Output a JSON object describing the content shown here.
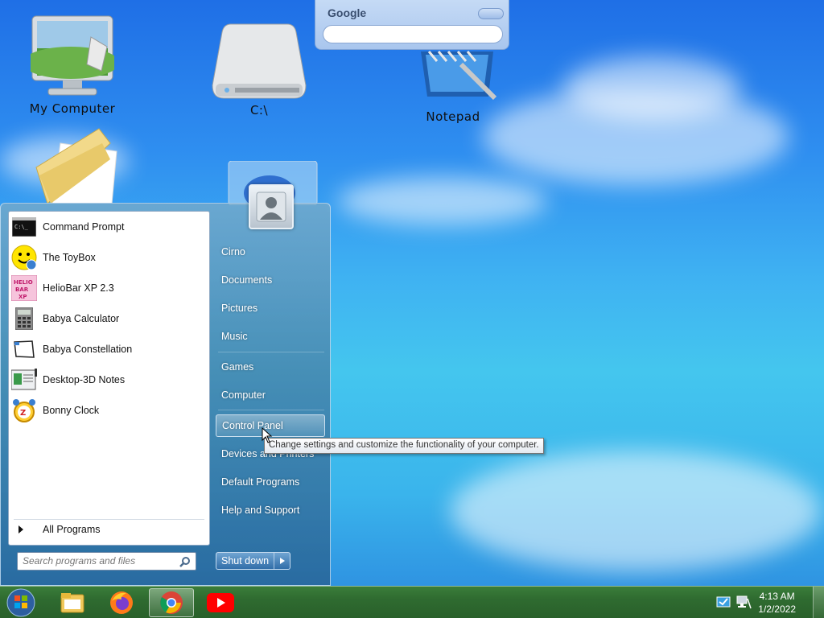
{
  "desktop": {
    "icons": [
      {
        "label": "My Computer"
      },
      {
        "label": "C:\\"
      },
      {
        "label": "Notepad"
      }
    ]
  },
  "gadget": {
    "title": "Google",
    "search_value": ""
  },
  "start_menu": {
    "programs": [
      {
        "label": "Command Prompt",
        "icon": "command-prompt-icon"
      },
      {
        "label": "The ToyBox",
        "icon": "smiley-icon"
      },
      {
        "label": "HelioBar XP 2.3",
        "icon": "heliobar-icon"
      },
      {
        "label": "Babya Calculator",
        "icon": "calculator-icon"
      },
      {
        "label": "Babya Constellation",
        "icon": "constellation-icon"
      },
      {
        "label": "Desktop-3D Notes",
        "icon": "notes-icon"
      },
      {
        "label": "Bonny Clock",
        "icon": "alarm-clock-icon"
      }
    ],
    "all_programs": "All Programs",
    "search_placeholder": "Search programs and files",
    "right_items": [
      {
        "label": "Cirno"
      },
      {
        "label": "Documents"
      },
      {
        "label": "Pictures"
      },
      {
        "label": "Music"
      },
      {
        "label": "Games"
      },
      {
        "label": "Computer"
      },
      {
        "label": "Control Panel"
      },
      {
        "label": "Devices and Printers"
      },
      {
        "label": "Default Programs"
      },
      {
        "label": "Help and Support"
      }
    ],
    "shutdown_label": "Shut down",
    "tooltip": "Change settings and customize the functionality of your computer."
  },
  "taskbar": {
    "time": "4:13 AM",
    "date": "1/2/2022",
    "apps": [
      "file-explorer-icon",
      "firefox-icon",
      "chrome-icon",
      "youtube-icon"
    ]
  }
}
